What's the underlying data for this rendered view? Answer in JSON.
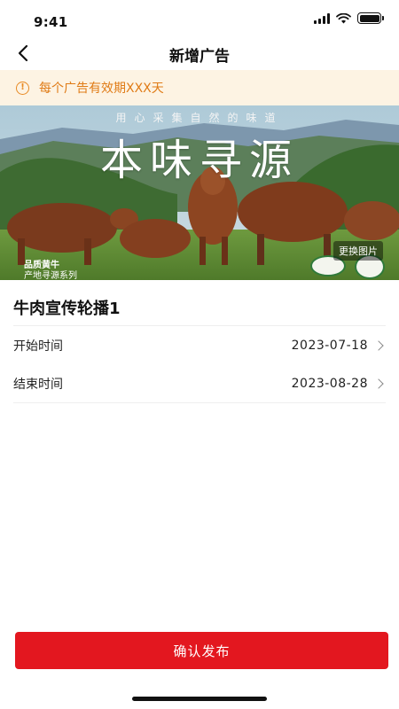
{
  "status_bar": {
    "time": "9:41"
  },
  "nav": {
    "title": "新增广告",
    "back_icon": "chevron-left-icon"
  },
  "notice": {
    "text": "每个广告有效期XXX天",
    "icon": "info-circle-icon",
    "color": "#e07b16",
    "background": "#fdf3e3"
  },
  "banner": {
    "tagline": "用心采集自然的味道",
    "headline": "本味寻源",
    "brand": "品质黄牛",
    "series": "产地寻源系列",
    "change_image_label": "更换图片"
  },
  "ad": {
    "name": "牛肉宣传轮播1",
    "start_label": "开始时间",
    "start_value": "2023-07-18",
    "end_label": "结束时间",
    "end_value": "2023-08-28"
  },
  "submit": {
    "label": "确认发布",
    "color": "#e3171f"
  }
}
